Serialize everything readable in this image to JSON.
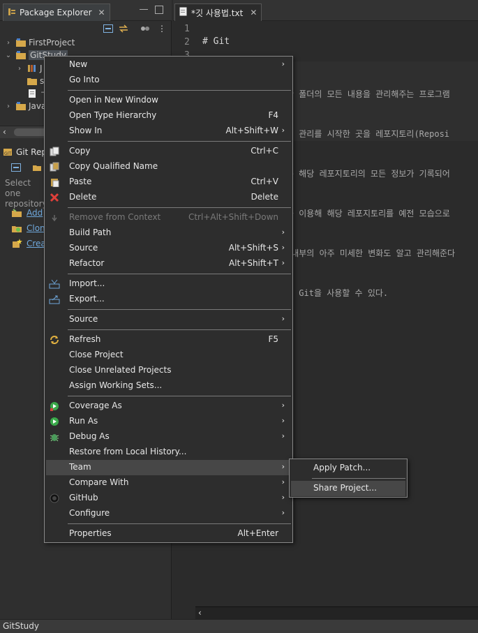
{
  "package_explorer": {
    "tab_label": "Package Explorer",
    "tree": [
      {
        "label": "FirstProject",
        "expanded": false
      },
      {
        "label": "GitStudy",
        "expanded": true,
        "selected": true
      },
      {
        "label": "J",
        "expanded": false
      },
      {
        "label": "s",
        "expanded": false
      },
      {
        "label": "ㄱ",
        "expanded": false
      },
      {
        "label": "Java",
        "expanded": false
      }
    ]
  },
  "git_repositories": {
    "tab_label": "Git Rep",
    "help_text": "Select one repository",
    "links": [
      "Add",
      "Clon",
      "Crea"
    ]
  },
  "editor": {
    "tab_label": "*깃 사용법.txt",
    "line_numbers": [
      "1",
      "2",
      "3"
    ],
    "code_lines": [
      "",
      "# Git"
    ],
    "visible_text_fragments": [
      "한 폴더의 모든 내용을 관리해주는 프로그램",
      "해 관리를 시작한 곳을 레포지토리(Reposi",
      "는 해당 레포지토리의 모든 정보가 기록되어",
      "를 이용해 해당 레포지토리를 예전 모습으로",
      " 내부의 아주 미세한 변화도 알고 관리해준다",
      "된 Git을 사용할 수 있다."
    ]
  },
  "status_bar": {
    "text": "GitStudy"
  },
  "context_menu": {
    "groups": [
      [
        {
          "label": "New",
          "shortcut": "",
          "submenu": true,
          "icon": ""
        },
        {
          "label": "Go Into",
          "shortcut": "",
          "submenu": false,
          "icon": ""
        }
      ],
      [
        {
          "label": "Open in New Window",
          "shortcut": "",
          "submenu": false,
          "icon": ""
        },
        {
          "label": "Open Type Hierarchy",
          "shortcut": "F4",
          "submenu": false,
          "icon": ""
        },
        {
          "label": "Show In",
          "shortcut": "Alt+Shift+W",
          "submenu": true,
          "icon": ""
        }
      ],
      [
        {
          "label": "Copy",
          "shortcut": "Ctrl+C",
          "submenu": false,
          "icon": "copy-icon"
        },
        {
          "label": "Copy Qualified Name",
          "shortcut": "",
          "submenu": false,
          "icon": "copy-qualified-icon"
        },
        {
          "label": "Paste",
          "shortcut": "Ctrl+V",
          "submenu": false,
          "icon": "paste-icon"
        },
        {
          "label": "Delete",
          "shortcut": "Delete",
          "submenu": false,
          "icon": "delete-icon"
        }
      ],
      [
        {
          "label": "Remove from Context",
          "shortcut": "Ctrl+Alt+Shift+Down",
          "submenu": false,
          "icon": "remove-context-icon",
          "disabled": true
        },
        {
          "label": "Build Path",
          "shortcut": "",
          "submenu": true,
          "icon": ""
        },
        {
          "label": "Source",
          "shortcut": "Alt+Shift+S",
          "submenu": true,
          "icon": ""
        },
        {
          "label": "Refactor",
          "shortcut": "Alt+Shift+T",
          "submenu": true,
          "icon": ""
        }
      ],
      [
        {
          "label": "Import...",
          "shortcut": "",
          "submenu": false,
          "icon": "import-icon"
        },
        {
          "label": "Export...",
          "shortcut": "",
          "submenu": false,
          "icon": "export-icon"
        }
      ],
      [
        {
          "label": "Source",
          "shortcut": "",
          "submenu": true,
          "icon": ""
        }
      ],
      [
        {
          "label": "Refresh",
          "shortcut": "F5",
          "submenu": false,
          "icon": "refresh-icon"
        },
        {
          "label": "Close Project",
          "shortcut": "",
          "submenu": false,
          "icon": ""
        },
        {
          "label": "Close Unrelated Projects",
          "shortcut": "",
          "submenu": false,
          "icon": ""
        },
        {
          "label": "Assign Working Sets...",
          "shortcut": "",
          "submenu": false,
          "icon": ""
        }
      ],
      [
        {
          "label": "Coverage As",
          "shortcut": "",
          "submenu": true,
          "icon": "coverage-icon"
        },
        {
          "label": "Run As",
          "shortcut": "",
          "submenu": true,
          "icon": "run-icon"
        },
        {
          "label": "Debug As",
          "shortcut": "",
          "submenu": true,
          "icon": "debug-icon"
        },
        {
          "label": "Restore from Local History...",
          "shortcut": "",
          "submenu": false,
          "icon": ""
        },
        {
          "label": "Team",
          "shortcut": "",
          "submenu": true,
          "icon": "",
          "highlighted": true
        },
        {
          "label": "Compare With",
          "shortcut": "",
          "submenu": true,
          "icon": ""
        },
        {
          "label": "GitHub",
          "shortcut": "",
          "submenu": true,
          "icon": "github-icon"
        },
        {
          "label": "Configure",
          "shortcut": "",
          "submenu": true,
          "icon": ""
        }
      ],
      [
        {
          "label": "Properties",
          "shortcut": "Alt+Enter",
          "submenu": false,
          "icon": ""
        }
      ]
    ]
  },
  "team_submenu": {
    "items": [
      {
        "label": "Apply Patch..."
      },
      {
        "label": "Share Project...",
        "highlighted": true
      }
    ]
  },
  "colors": {
    "background": "#2b2b2b",
    "menu_bg": "#2d2d2d",
    "menu_highlight": "#474747",
    "link": "#6fa8dc"
  }
}
